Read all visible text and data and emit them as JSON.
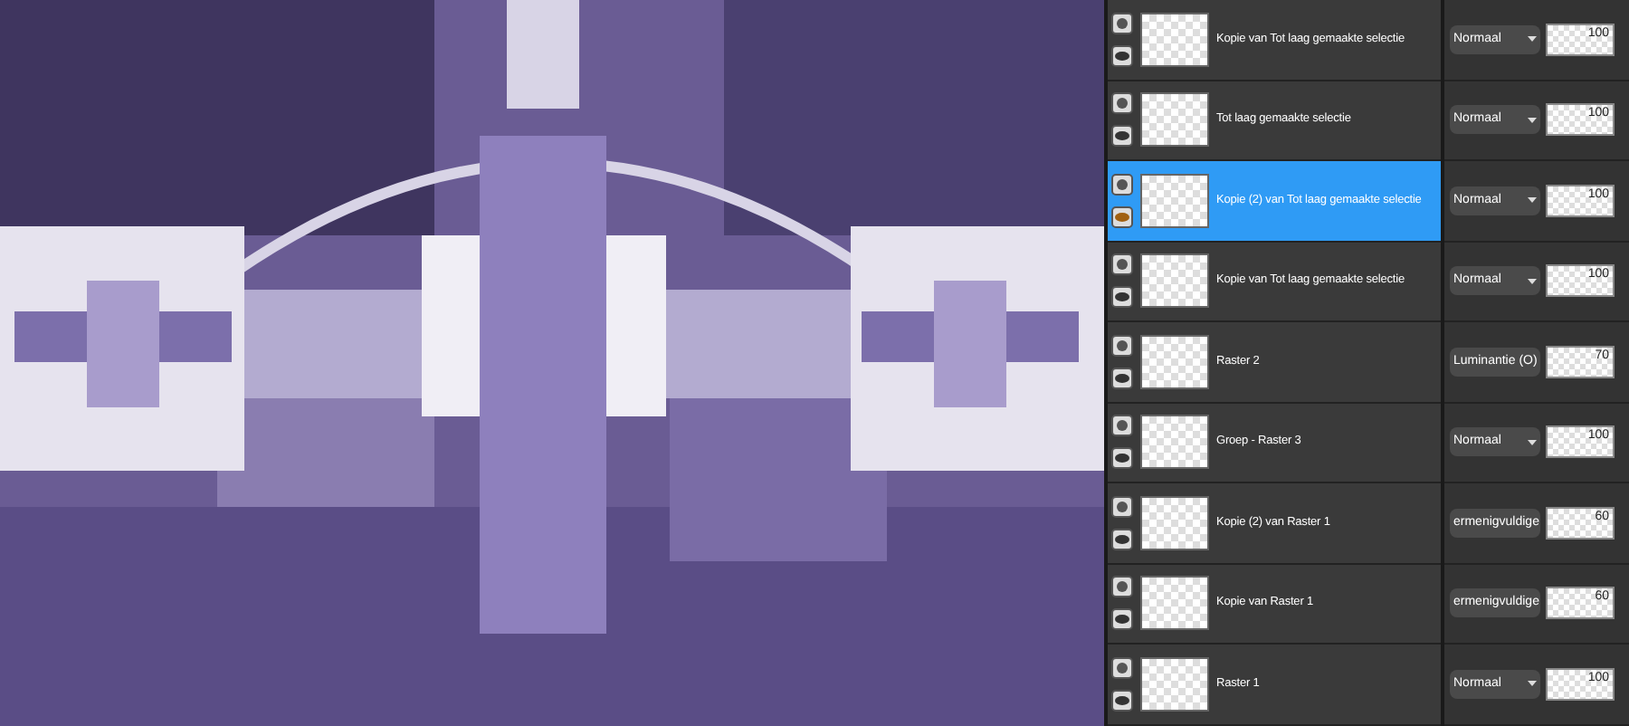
{
  "layers": [
    {
      "name": "Kopie van Tot laag gemaakte selectie",
      "selected": false,
      "blend_mode": "Normaal",
      "opacity": "100"
    },
    {
      "name": "Tot laag gemaakte selectie",
      "selected": false,
      "blend_mode": "Normaal",
      "opacity": "100"
    },
    {
      "name": "Kopie (2) van Tot laag gemaakte selectie",
      "selected": true,
      "blend_mode": "Normaal",
      "opacity": "100"
    },
    {
      "name": "Kopie van Tot laag gemaakte selectie",
      "selected": false,
      "blend_mode": "Normaal",
      "opacity": "100"
    },
    {
      "name": "Raster 2",
      "selected": false,
      "blend_mode": "Luminantie (O)",
      "opacity": "70"
    },
    {
      "name": "Groep - Raster 3",
      "selected": false,
      "blend_mode": "Normaal",
      "opacity": "100"
    },
    {
      "name": "Kopie (2) van Raster 1",
      "selected": false,
      "blend_mode": "ermenigvuldige",
      "opacity": "60"
    },
    {
      "name": "Kopie van Raster 1",
      "selected": false,
      "blend_mode": "ermenigvuldige",
      "opacity": "60"
    },
    {
      "name": "Raster 1",
      "selected": false,
      "blend_mode": "Normaal",
      "opacity": "100"
    }
  ]
}
